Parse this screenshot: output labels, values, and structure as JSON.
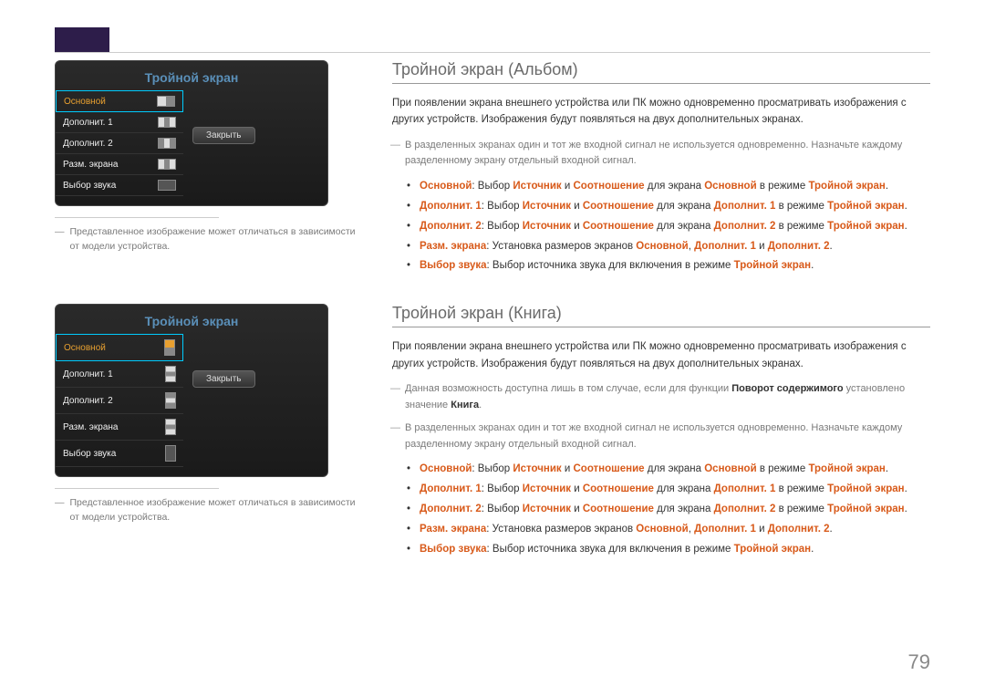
{
  "osd": {
    "title": "Тройной экран",
    "items": [
      "Основной",
      "Дополнит. 1",
      "Дополнит. 2",
      "Разм. экрана",
      "Выбор звука"
    ],
    "close": "Закрыть"
  },
  "note": "Представленное изображение может отличаться в зависимости от модели устройства.",
  "section1": {
    "title": "Тройной экран (Альбом)",
    "intro": "При появлении экрана внешнего устройства или ПК можно одновременно просматривать изображения с других устройств. Изображения будут появляться на двух дополнительных экранах.",
    "dash1": "В разделенных экранах один и тот же входной сигнал не используется одновременно. Назначьте каждому разделенному экрану отдельный входной сигнал.",
    "b1": {
      "a": "Основной",
      "b": ": Выбор ",
      "c": "Источник",
      "d": " и ",
      "e": "Соотношение",
      "f": " для экрана ",
      "g": "Основной",
      "h": " в режиме ",
      "i": "Тройной экран",
      "j": "."
    },
    "b2": {
      "a": "Дополнит. 1",
      "b": ": Выбор ",
      "c": "Источник",
      "d": " и ",
      "e": "Соотношение",
      "f": " для экрана ",
      "g": "Дополнит. 1",
      "h": " в режиме ",
      "i": "Тройной экран",
      "j": "."
    },
    "b3": {
      "a": "Дополнит. 2",
      "b": ": Выбор ",
      "c": "Источник",
      "d": " и ",
      "e": "Соотношение",
      "f": " для экрана ",
      "g": "Дополнит. 2",
      "h": " в режиме ",
      "i": "Тройной экран",
      "j": "."
    },
    "b4": {
      "a": "Разм. экрана",
      "b": ": Установка размеров экранов ",
      "c": "Основной",
      "d": ", ",
      "e": "Дополнит. 1",
      "f": " и ",
      "g": "Дополнит. 2",
      "h": "."
    },
    "b5": {
      "a": "Выбор звука",
      "b": ": Выбор источника звука для включения в режиме ",
      "c": "Тройной экран",
      "d": "."
    }
  },
  "section2": {
    "title": "Тройной экран (Книга)",
    "intro": "При появлении экрана внешнего устройства или ПК можно одновременно просматривать изображения с других устройств. Изображения будут появляться на двух дополнительных экранах.",
    "dash0a": "Данная возможность доступна лишь в том случае, если для функции ",
    "dash0b": "Поворот содержимого",
    "dash0c": " установлено значение ",
    "dash0d": "Книга",
    "dash0e": ".",
    "dash1": "В разделенных экранах один и тот же входной сигнал не используется одновременно. Назначьте каждому разделенному экрану отдельный входной сигнал."
  },
  "pageNum": "79"
}
